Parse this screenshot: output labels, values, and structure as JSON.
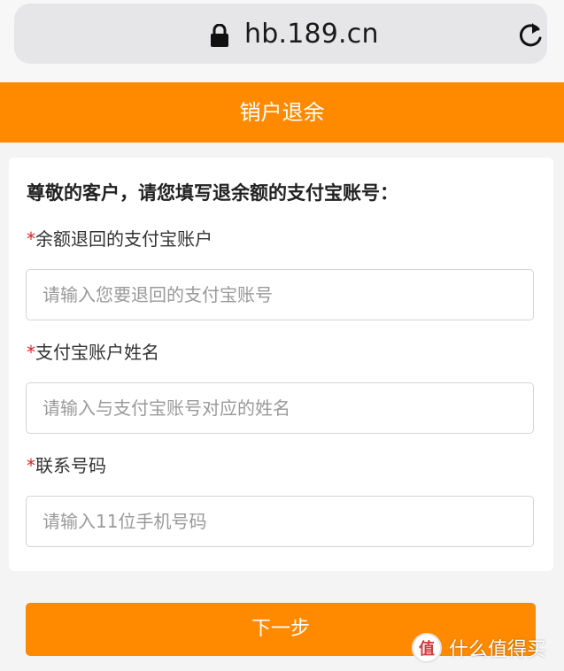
{
  "browser": {
    "url": "hb.189.cn"
  },
  "header": {
    "title": "销户退余"
  },
  "form": {
    "intro": "尊敬的客户，请您填写退余额的支付宝账号：",
    "required_mark": "*",
    "fields": [
      {
        "label": "余额退回的支付宝账户",
        "placeholder": "请输入您要退回的支付宝账号",
        "value": ""
      },
      {
        "label": "支付宝账户姓名",
        "placeholder": "请输入与支付宝账号对应的姓名",
        "value": ""
      },
      {
        "label": "联系号码",
        "placeholder": "请输入11位手机号码",
        "value": ""
      }
    ]
  },
  "actions": {
    "next_label": "下一步"
  },
  "watermark": {
    "logo_char": "值",
    "text": "什么值得买"
  },
  "colors": {
    "accent": "#ff8a00",
    "required": "#e02020"
  }
}
